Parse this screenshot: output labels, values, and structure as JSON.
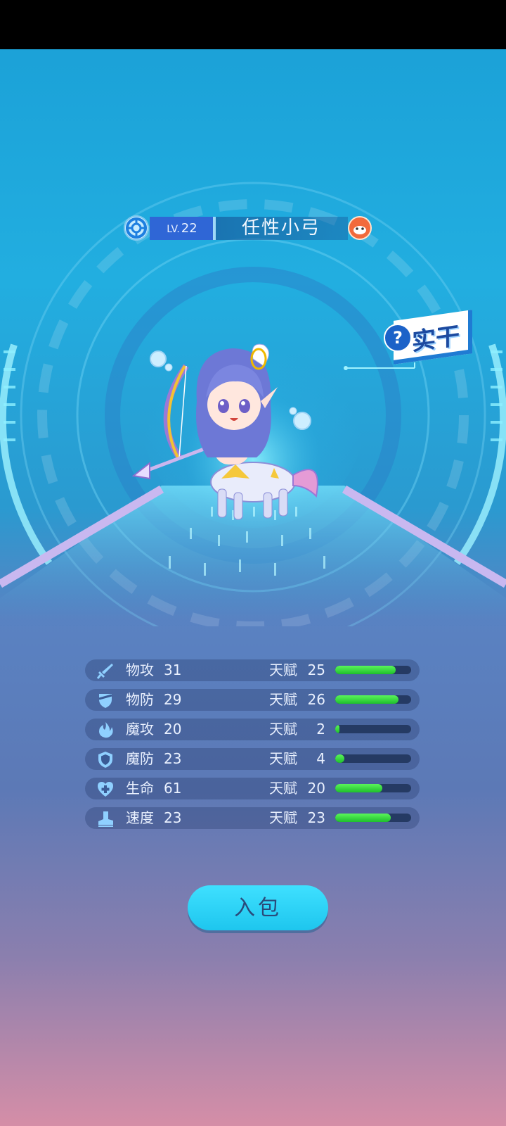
{
  "pet": {
    "level_prefix": "LV.",
    "level": "22",
    "name": "任性小弓",
    "type_tag": "实干",
    "type_help": "?"
  },
  "stats": [
    {
      "icon": "sword-icon",
      "name": "物攻",
      "value": "31",
      "talent_label": "天赋",
      "talent": "25",
      "fill": 0.8
    },
    {
      "icon": "armor-icon",
      "name": "物防",
      "value": "29",
      "talent_label": "天赋",
      "talent": "26",
      "fill": 0.83
    },
    {
      "icon": "flame-icon",
      "name": "魔攻",
      "value": "20",
      "talent_label": "天赋",
      "talent": "2",
      "fill": 0.06
    },
    {
      "icon": "shield-icon",
      "name": "魔防",
      "value": "23",
      "talent_label": "天赋",
      "talent": "4",
      "fill": 0.12
    },
    {
      "icon": "heart-plus-icon",
      "name": "生命",
      "value": "61",
      "talent_label": "天赋",
      "talent": "20",
      "fill": 0.62
    },
    {
      "icon": "boot-icon",
      "name": "速度",
      "value": "23",
      "talent_label": "天赋",
      "talent": "23",
      "fill": 0.73
    }
  ],
  "actions": {
    "pack_label": "入包"
  },
  "colors": {
    "bar_fill": "#2ed43a",
    "bar_track": "#253a63",
    "button": "#28d2f5",
    "level_box": "#2f66d6"
  }
}
